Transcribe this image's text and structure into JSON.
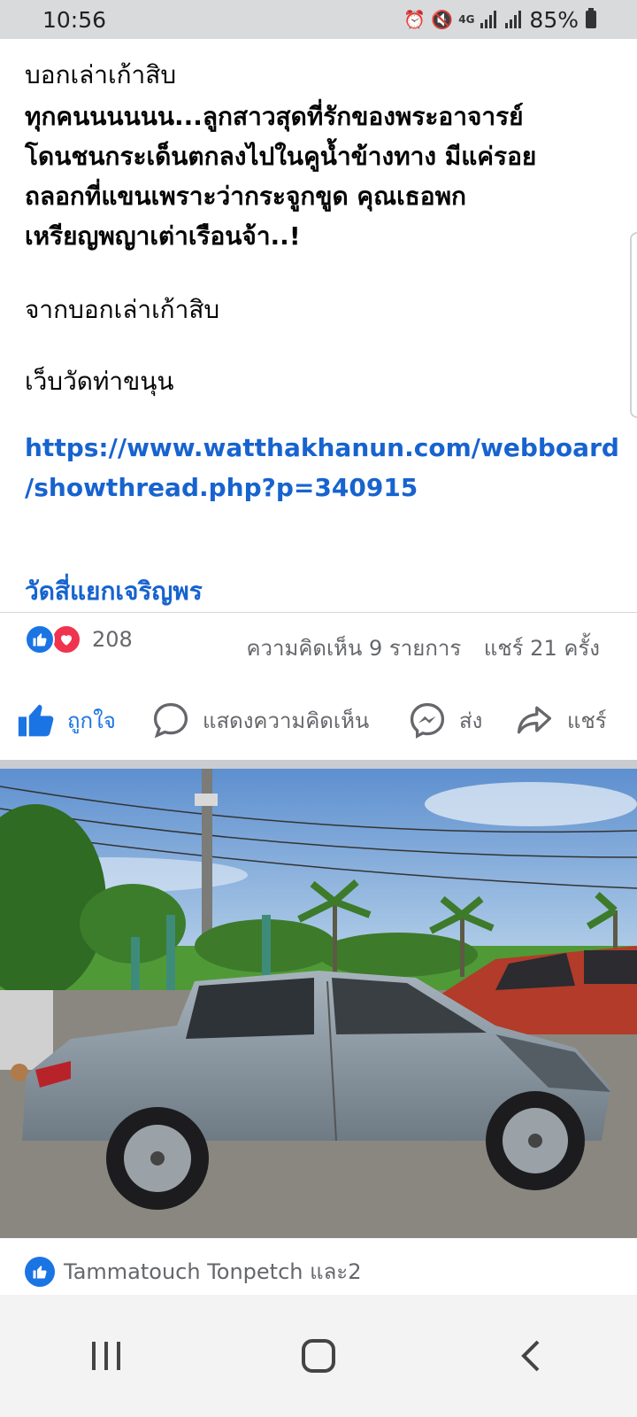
{
  "status_bar": {
    "time": "10:56",
    "network": "4G",
    "battery": "85%"
  },
  "post": {
    "lines": [
      {
        "text": "บอกเล่าเก้าสิบ",
        "bold": false
      },
      {
        "text": "ทุกคนนนนนน...ลูกสาวสุดที่รักของพระอาจารย์",
        "bold": true
      },
      {
        "text": "โดนชนกระเด็นตกลงไปในคูน้ำข้างทาง มีแค่รอย",
        "bold": true
      },
      {
        "text": "ถลอกที่แขนเพราะว่ากระจูกขูด  คุณเธอพก",
        "bold": true
      },
      {
        "text": "เหรียญพญาเต่าเรือนจ้า..!",
        "bold": true
      }
    ],
    "source_label": "จากบอกเล่าเก้าสิบ",
    "site_label": "เว็บวัดท่าขนุน",
    "url_line1": "https://www.watthakhanun.com/webboard",
    "url_line2": "/showthread.php?p=340915",
    "group_name": "วัดสี่แยกเจริญพร"
  },
  "reactions": {
    "count": "208",
    "comments": "ความคิดเห็น 9 รายการ",
    "shares": "แชร์ 21 ครั้ง"
  },
  "actions": {
    "like": "ถูกใจ",
    "comment": "แสดงความคิดเห็น",
    "send": "ส่ง",
    "share": "แชร์"
  },
  "photo": {
    "liked_by": "Tammatouch Tonpetch และ2"
  },
  "icons": {
    "like": "thumbs-up-icon",
    "love": "heart-icon",
    "comment": "comment-bubble-icon",
    "send": "messenger-icon",
    "share": "share-arrow-icon"
  },
  "colors": {
    "facebook_blue": "#1b74e4",
    "link_blue": "#1763cf",
    "love_red": "#f0334e",
    "muted_text": "#65676b"
  }
}
